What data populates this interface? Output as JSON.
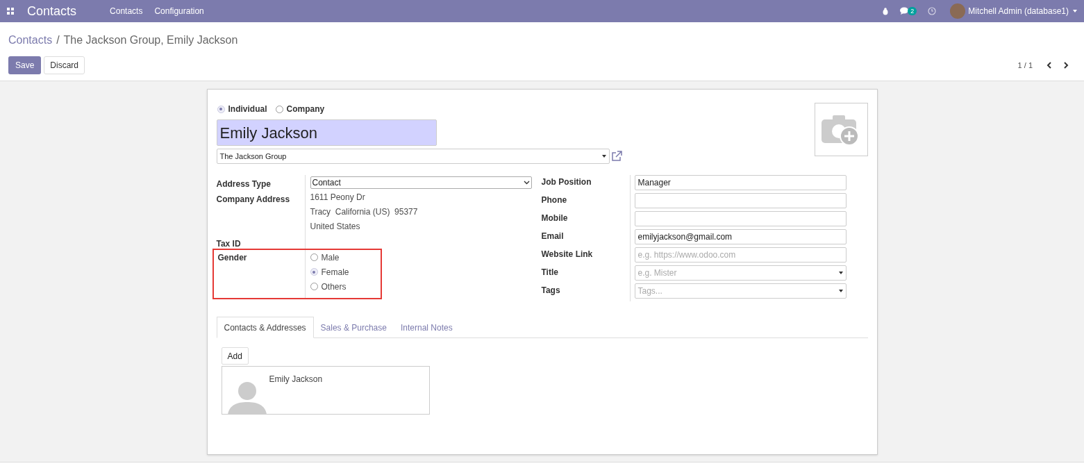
{
  "navbar": {
    "app_name": "Contacts",
    "menu": [
      "Contacts",
      "Configuration"
    ],
    "messages_badge": "2",
    "user": "Mitchell Admin (database1)"
  },
  "breadcrumb": {
    "parent": "Contacts",
    "separator": "/",
    "current": "The Jackson Group, Emily Jackson"
  },
  "buttons": {
    "save": "Save",
    "discard": "Discard"
  },
  "pager": "1 / 1",
  "form": {
    "company_type": [
      {
        "label": "Individual",
        "selected": true
      },
      {
        "label": "Company",
        "selected": false
      }
    ],
    "name": "Emily Jackson",
    "company": "The Jackson Group",
    "left_fields": [
      {
        "kind": "select",
        "label": "Address Type",
        "value": "Contact"
      },
      {
        "kind": "address",
        "label": "Company Address",
        "lines": [
          "1611 Peony Dr",
          "Tracy  California (US)  95377",
          "United States"
        ]
      },
      {
        "kind": "empty",
        "label": "Tax ID"
      }
    ],
    "gender": {
      "label": "Gender",
      "highlighted": true,
      "options": [
        {
          "label": "Male",
          "selected": false
        },
        {
          "label": "Female",
          "selected": true
        },
        {
          "label": "Others",
          "selected": false
        }
      ]
    },
    "right_fields": [
      {
        "kind": "text",
        "label": "Job Position",
        "value": "Manager"
      },
      {
        "kind": "text",
        "label": "Phone"
      },
      {
        "kind": "text",
        "label": "Mobile"
      },
      {
        "kind": "text",
        "label": "Email",
        "value": "emilyjackson@gmail.com"
      },
      {
        "kind": "text",
        "label": "Website Link",
        "placeholder": "e.g. https://www.odoo.com"
      },
      {
        "kind": "select",
        "label": "Title",
        "placeholder": "e.g. Mister"
      },
      {
        "kind": "select",
        "label": "Tags",
        "placeholder": "Tags..."
      }
    ],
    "tabs": [
      {
        "label": "Contacts & Addresses",
        "selected": true
      },
      {
        "label": "Sales & Purchase",
        "selected": false
      },
      {
        "label": "Internal Notes",
        "selected": false
      }
    ],
    "add_button": "Add",
    "contact_cards": [
      {
        "name": "Emily Jackson"
      }
    ]
  }
}
